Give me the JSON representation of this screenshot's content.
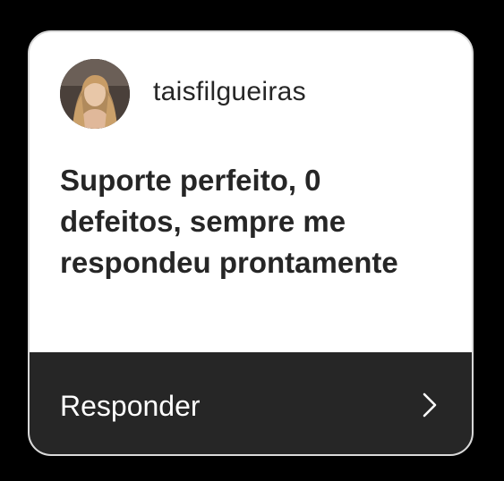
{
  "colors": {
    "background": "#000000",
    "card": "#ffffff",
    "text": "#262626",
    "reply_bar": "#262626",
    "reply_text": "#ffffff"
  },
  "notification": {
    "avatar_icon": "profile-photo-avatar",
    "username": "taisfilgueiras",
    "message": "Suporte perfeito, 0 defeitos, sempre me respondeu prontamente"
  },
  "reply": {
    "label": "Responder",
    "icon": "chevron-right-icon"
  }
}
